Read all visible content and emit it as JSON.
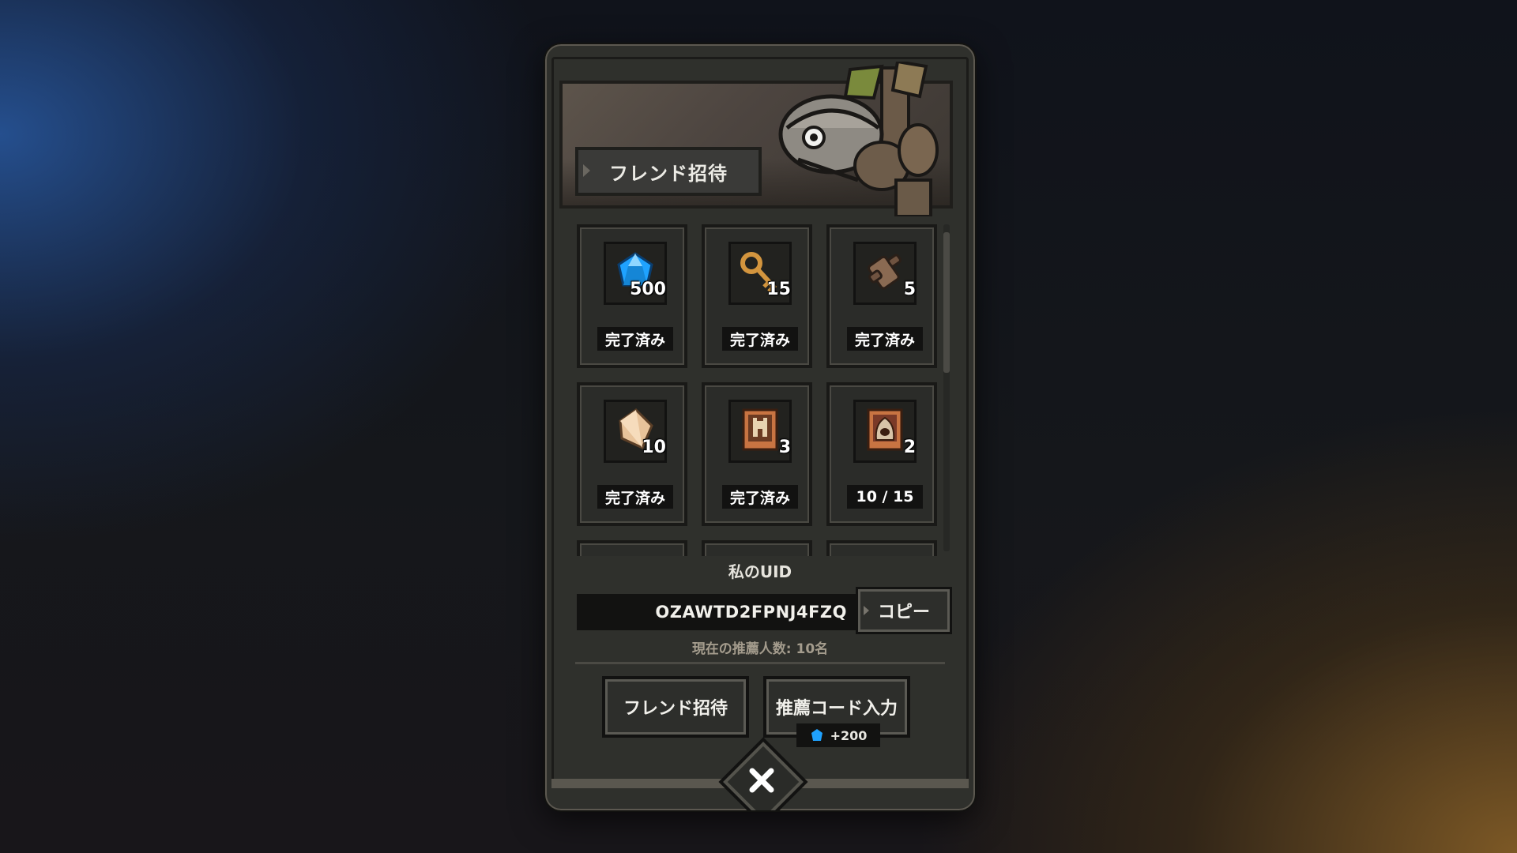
{
  "dialog": {
    "title": "フレンド招待",
    "uid_label": "私のUID",
    "uid_value": "OZAWTD2FPNJ4FZQ",
    "copy_label": "コピー",
    "referral_count_text": "現在の推薦人数: 10名",
    "invite_button_label": "フレンド招待",
    "code_button_label": "推薦コード入力",
    "code_bonus": "+200"
  },
  "rewards": [
    {
      "icon": "blue-gem-icon",
      "count": "500",
      "status": "完了済み"
    },
    {
      "icon": "key-icon",
      "count": "15",
      "status": "完了済み"
    },
    {
      "icon": "scroll-icon",
      "count": "5",
      "status": "完了済み"
    },
    {
      "icon": "crystal-icon",
      "count": "10",
      "status": "完了済み"
    },
    {
      "icon": "castle-card-icon",
      "count": "3",
      "status": "完了済み"
    },
    {
      "icon": "hooded-hero-card-icon",
      "count": "2",
      "status": "10 / 15"
    }
  ],
  "colors": {
    "panel": "#2f302c",
    "status_bg": "#121211",
    "gem": "#1fa2ff",
    "card_frame": "#c87442"
  }
}
